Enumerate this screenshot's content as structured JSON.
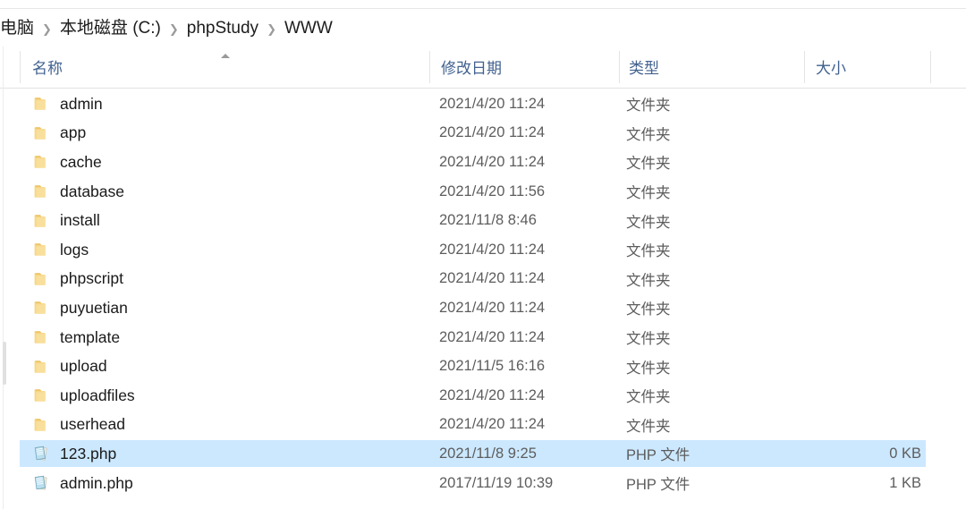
{
  "window": {
    "app": "Windows File Explorer"
  },
  "breadcrumb": {
    "separator": "❯",
    "items": [
      {
        "label": "电脑"
      },
      {
        "label": "本地磁盘 (C:)"
      },
      {
        "label": "phpStudy"
      },
      {
        "label": "WWW"
      }
    ]
  },
  "columns": {
    "name": {
      "label": "名称",
      "sort": "ascending"
    },
    "date": {
      "label": "修改日期"
    },
    "type": {
      "label": "类型"
    },
    "size": {
      "label": "大小"
    }
  },
  "colors": {
    "selection": "#cce8ff",
    "header_text": "#41618f",
    "folder_icon": "#f7d786",
    "php_icon": "#b9dff0",
    "row_text": "#1a1a1a",
    "secondary_text": "#5d5d5d"
  },
  "rows": [
    {
      "name": "admin",
      "date": "2021/4/20 11:24",
      "type": "文件夹",
      "size": "",
      "icon": "folder-icon",
      "selected": false
    },
    {
      "name": "app",
      "date": "2021/4/20 11:24",
      "type": "文件夹",
      "size": "",
      "icon": "folder-icon",
      "selected": false
    },
    {
      "name": "cache",
      "date": "2021/4/20 11:24",
      "type": "文件夹",
      "size": "",
      "icon": "folder-icon",
      "selected": false
    },
    {
      "name": "database",
      "date": "2021/4/20 11:56",
      "type": "文件夹",
      "size": "",
      "icon": "folder-icon",
      "selected": false
    },
    {
      "name": "install",
      "date": "2021/11/8 8:46",
      "type": "文件夹",
      "size": "",
      "icon": "folder-icon",
      "selected": false
    },
    {
      "name": "logs",
      "date": "2021/4/20 11:24",
      "type": "文件夹",
      "size": "",
      "icon": "folder-icon",
      "selected": false
    },
    {
      "name": "phpscript",
      "date": "2021/4/20 11:24",
      "type": "文件夹",
      "size": "",
      "icon": "folder-icon",
      "selected": false
    },
    {
      "name": "puyuetian",
      "date": "2021/4/20 11:24",
      "type": "文件夹",
      "size": "",
      "icon": "folder-icon",
      "selected": false
    },
    {
      "name": "template",
      "date": "2021/4/20 11:24",
      "type": "文件夹",
      "size": "",
      "icon": "folder-icon",
      "selected": false
    },
    {
      "name": "upload",
      "date": "2021/11/5 16:16",
      "type": "文件夹",
      "size": "",
      "icon": "folder-icon",
      "selected": false
    },
    {
      "name": "uploadfiles",
      "date": "2021/4/20 11:24",
      "type": "文件夹",
      "size": "",
      "icon": "folder-icon",
      "selected": false
    },
    {
      "name": "userhead",
      "date": "2021/4/20 11:24",
      "type": "文件夹",
      "size": "",
      "icon": "folder-icon",
      "selected": false
    },
    {
      "name": "123.php",
      "date": "2021/11/8 9:25",
      "type": "PHP 文件",
      "size": "0 KB",
      "icon": "php-file-icon",
      "selected": true
    },
    {
      "name": "admin.php",
      "date": "2017/11/19 10:39",
      "type": "PHP 文件",
      "size": "1 KB",
      "icon": "php-file-icon",
      "selected": false
    }
  ]
}
